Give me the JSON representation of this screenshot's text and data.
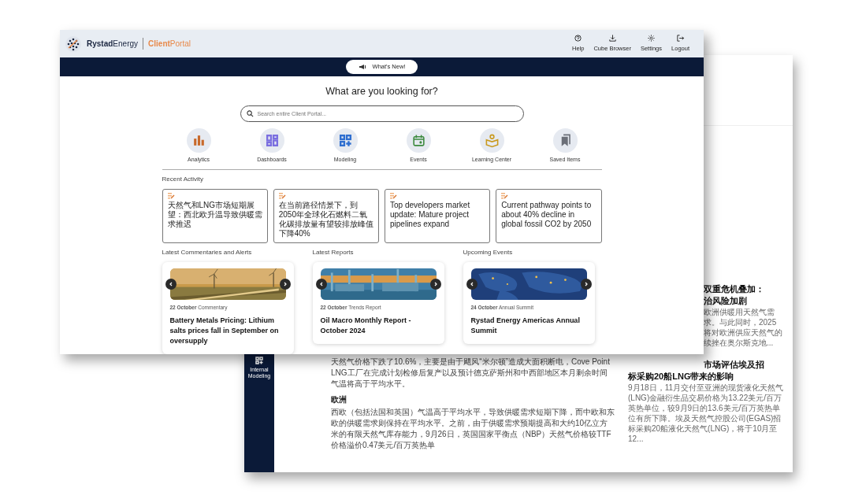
{
  "back_window": {
    "sidebar": {
      "items": [
        {
          "label": "Internal Modeling"
        }
      ]
    },
    "article": [
      {
        "kind": "paragraph",
        "text": "天然气价格下跌了10.6%，主要是由于飓风“米尔顿”造成大面积断电，Cove Point LNG工厂在完成计划检修后复产以及预计德克萨斯州和中西部地区本月剩余时间气温将高于平均水平。"
      },
      {
        "kind": "heading",
        "text": "欧洲"
      },
      {
        "kind": "paragraph",
        "text": "西欧（包括法国和英国）气温高于平均水平，导致供暖需求短期下降，而中欧和东欧的供暖需求则保持在平均水平。之前，由于供暖需求预期提高和大约10亿立方米的有限天然气库存能力，9月26日，英国国家平衡点（NBP）天然气价格较TTF价格溢价0.47美元/百万英热单"
      }
    ],
    "related": [
      {
        "title": [
          {
            "text": "双重危机叠加：",
            "covered": true
          },
          {
            "text": "治风险加剧",
            "covered": true
          }
        ],
        "body": [
          {
            "text": "欧洲供暖用天然气需",
            "covered": true
          },
          {
            "text": "求。与此同时，2025",
            "covered": true
          },
          {
            "text": "将对欧洲供应天然气的",
            "covered": true
          },
          {
            "text": "续挫在奥尔斯克地...",
            "covered": true
          }
        ]
      },
      {
        "title": [
          {
            "text": "市场评估埃及招",
            "covered": true
          },
          {
            "text": "标采购20船LNG带来的影响",
            "covered": false
          }
        ],
        "body": [
          {
            "text": "9月18日，11月交付至亚洲的现货液化天然气(LNG)金融衍生品交易价格为13.22美元/百万英热单位，较9月9日的13.6美元/百万英热单位有所下降。埃及天然气控股公司(EGAS)招标采购20船液化天然气(LNG)，将于10月至12...",
            "covered": false
          }
        ]
      }
    ]
  },
  "front_window": {
    "brand": {
      "company": "**Rystad**Energy",
      "product": "**Client**Portal"
    },
    "actions": [
      {
        "label": "Help"
      },
      {
        "label": "Cube Browser"
      },
      {
        "label": "Settings"
      },
      {
        "label": "Logout"
      }
    ],
    "whats_new": "What's New!",
    "heading": "What are you looking for?",
    "search": {
      "placeholder": "Search entire Client Portal..."
    },
    "quick_links": [
      {
        "label": "Analytics",
        "color": "#c8692a"
      },
      {
        "label": "Dashboards",
        "color": "#7b6fe0"
      },
      {
        "label": "Modeling",
        "color": "#2f6fd0"
      },
      {
        "label": "Events",
        "color": "#3d8a3f"
      },
      {
        "label": "Learning Center",
        "color": "#c99a1f"
      },
      {
        "label": "Saved Items",
        "color": "#6b6f78"
      }
    ],
    "recent_activity": {
      "title": "Recent Activity",
      "items": [
        "天然气和LNG市场短期展望：西北欧升温导致供暖需求推迟",
        "在当前路径情景下，到2050年全球化石燃料二氧化碳排放量有望较排放峰值下降40%",
        "Top developers market update: Mature project pipelines expand",
        "Current pathway points to about 40% decline in global fossil CO2 by 2050"
      ]
    },
    "sections": [
      {
        "title": "Latest Commentaries and Alerts",
        "card": {
          "meta": "**22 October** Commentary",
          "title": "Battery Metals Pricing: Lithium salts prices fall in September on oversupply"
        }
      },
      {
        "title": "Latest Reports",
        "card": {
          "meta": "**22 October** Trends Report",
          "title": "Oil Macro Monthly Report - October 2024"
        }
      },
      {
        "title": "Upcoming Events",
        "card": {
          "meta": "**24 October** Annual Summit",
          "title": "Rystad Energy Americas Annual Summit"
        }
      }
    ]
  }
}
